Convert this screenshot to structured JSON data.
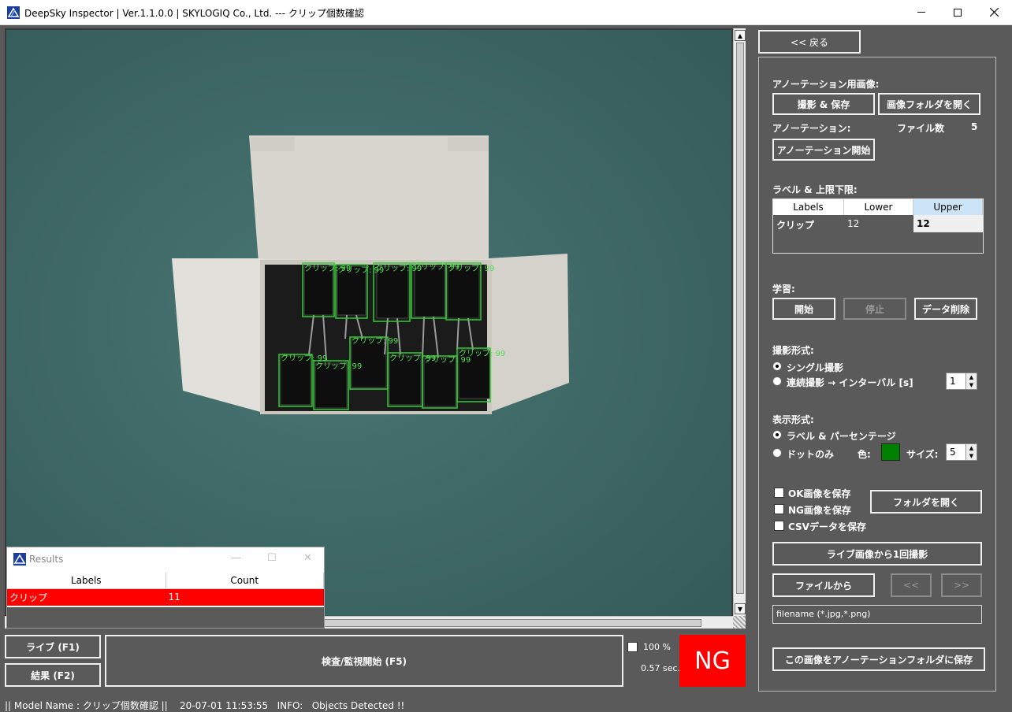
{
  "window": {
    "title": "DeepSky Inspector | Ver.1.1.0.0 | SKYLOGIQ Co., Ltd. --- クリップ個数確認"
  },
  "detections": {
    "label_text": "クリップ: 99"
  },
  "results_window": {
    "title": "Results",
    "columns": [
      "Labels",
      "Count"
    ],
    "rows": [
      {
        "label": "クリップ",
        "count": "11"
      }
    ]
  },
  "bottom_controls": {
    "live_button": "ライブ (F1)",
    "result_button": "結果 (F2)",
    "inspect_button": "検査/監視開始 (F5)",
    "zoom_label": "100 %",
    "time": "0.57 sec.",
    "verdict": "NG",
    "verdict_color": "#ff0000"
  },
  "status_bar": {
    "text": "|| Model Name : クリップ個数確認 ||    20-07-01 11:53:55   INFO:   Objects Detected !!"
  },
  "side_panel": {
    "back_button": "<< 戻る",
    "annotation_image_header": "アノーテーション用画像:",
    "capture_save_button": "撮影 & 保存",
    "open_image_folder_button": "画像フォルダを開く",
    "annotation_label": "アノーテーション:",
    "file_count_label": "ファイル数",
    "file_count": "5",
    "annotation_start_button": "アノーテーション開始",
    "label_limits_header": "ラベル & 上限下限:",
    "label_table": {
      "columns": [
        "Labels",
        "Lower",
        "Upper"
      ],
      "rows": [
        {
          "label": "クリップ",
          "lower": "12",
          "upper": "12"
        }
      ]
    },
    "learning_header": "学習:",
    "start_button": "開始",
    "stop_button": "停止",
    "delete_data_button": "データ削除",
    "capture_mode_header": "撮影形式:",
    "single_capture": "シングル撮影",
    "continuous_capture": "連続撮影 → インターバル [s]",
    "interval_value": "1",
    "display_mode_header": "表示形式:",
    "label_percentage": "ラベル & パーセンテージ",
    "dots_only": "ドットのみ",
    "color_label": "色:",
    "dot_color": "#008000",
    "size_label": "サイズ:",
    "size_value": "5",
    "save_ok_images": "OK画像を保存",
    "save_ng_images": "NG画像を保存",
    "save_csv": "CSVデータを保存",
    "open_folder_button": "フォルダを開く",
    "capture_from_live_button": "ライブ画像から1回撮影",
    "from_file_button": "ファイルから",
    "prev_button": "<<",
    "next_button": ">>",
    "filename_placeholder": "filename (*.jpg,*.png)",
    "save_to_annotation_button": "この画像をアノーテーションフォルダに保存"
  }
}
